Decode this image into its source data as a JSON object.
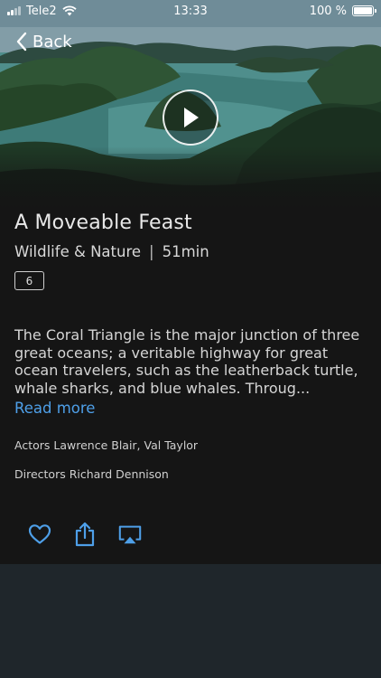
{
  "status_bar": {
    "carrier": "Tele2",
    "time": "13:33",
    "battery": "100 %"
  },
  "nav": {
    "back_label": "Back"
  },
  "video": {
    "title": "A Moveable Feast",
    "genre": "Wildlife & Nature",
    "separator": "|",
    "duration": "51min",
    "age_rating": "6",
    "description": "The Coral Triangle is the major junction of three great oceans; a veritable highway for great ocean travelers, such as the leatherback turtle, whale sharks, and blue whales. Throug...",
    "read_more": "Read more",
    "actors_line": "Actors Lawrence Blair, Val Taylor",
    "directors_line": "Directors Richard Dennison"
  },
  "actions": [
    {
      "icon": "heart-icon"
    },
    {
      "icon": "share-icon"
    },
    {
      "icon": "airplay-icon"
    }
  ],
  "colors": {
    "accent": "#4e9fe8",
    "content_bg": "#151515",
    "page_bg": "#1f262b"
  }
}
